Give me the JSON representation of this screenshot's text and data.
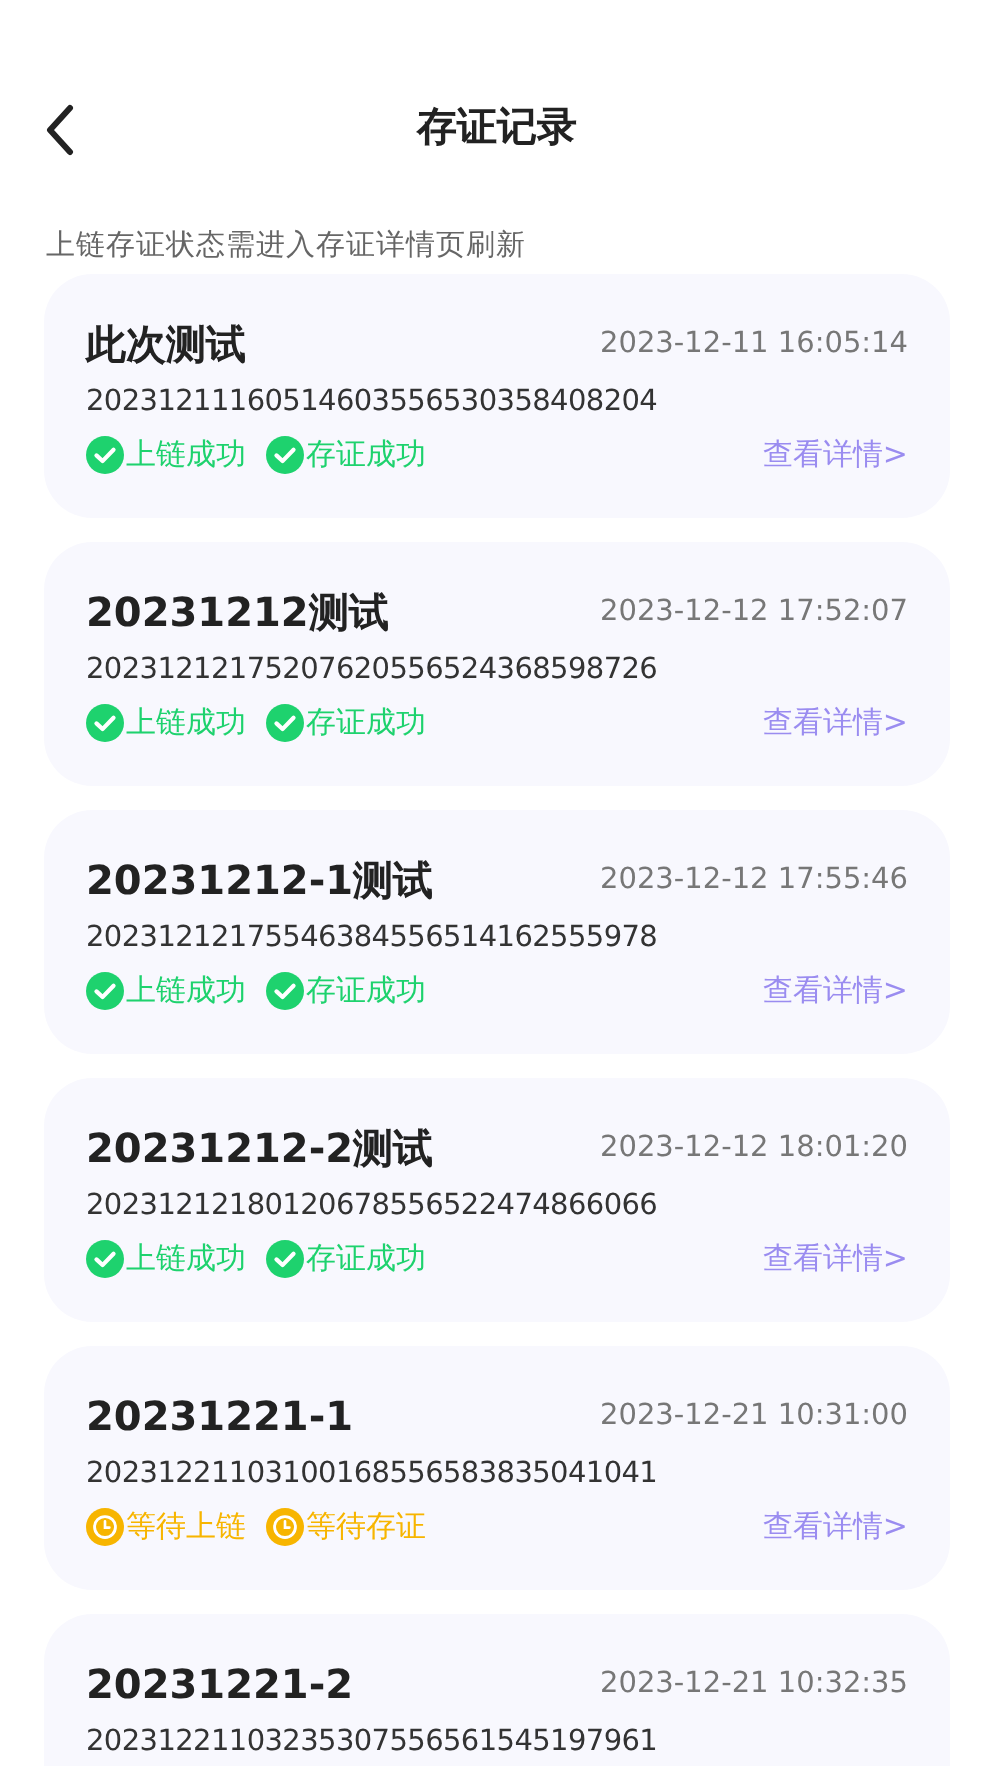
{
  "header": {
    "title": "存证记录"
  },
  "hint": "上链存证状态需进入存证详情页刷新",
  "records": [
    {
      "title": "此次测试",
      "time": "2023-12-11 16:05:14",
      "id": "20231211160514603556530358408204",
      "statuses": [
        {
          "kind": "success",
          "label": "上链成功"
        },
        {
          "kind": "success",
          "label": "存证成功"
        }
      ],
      "link": "查看详情>"
    },
    {
      "title": "20231212测试",
      "time": "2023-12-12 17:52:07",
      "id": "20231212175207620556524368598726",
      "statuses": [
        {
          "kind": "success",
          "label": "上链成功"
        },
        {
          "kind": "success",
          "label": "存证成功"
        }
      ],
      "link": "查看详情>"
    },
    {
      "title": "20231212-1测试",
      "time": "2023-12-12 17:55:46",
      "id": "20231212175546384556514162555978",
      "statuses": [
        {
          "kind": "success",
          "label": "上链成功"
        },
        {
          "kind": "success",
          "label": "存证成功"
        }
      ],
      "link": "查看详情>"
    },
    {
      "title": "20231212-2测试",
      "time": "2023-12-12 18:01:20",
      "id": "20231212180120678556522474866066",
      "statuses": [
        {
          "kind": "success",
          "label": "上链成功"
        },
        {
          "kind": "success",
          "label": "存证成功"
        }
      ],
      "link": "查看详情>"
    },
    {
      "title": "20231221-1",
      "time": "2023-12-21 10:31:00",
      "id": "20231221103100168556583835041041",
      "statuses": [
        {
          "kind": "pending",
          "label": "等待上链"
        },
        {
          "kind": "pending",
          "label": "等待存证"
        }
      ],
      "link": "查看详情>"
    },
    {
      "title": "20231221-2",
      "time": "2023-12-21 10:32:35",
      "id": "20231221103235307556561545197961"
    }
  ]
}
